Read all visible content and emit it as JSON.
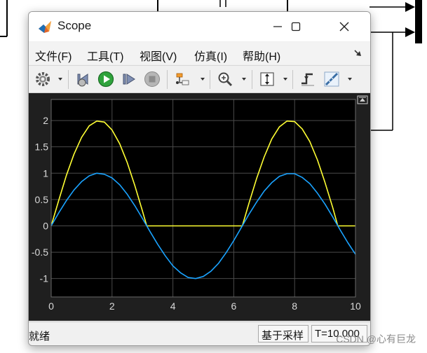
{
  "window": {
    "title": "Scope",
    "controls": {
      "minimize": "—",
      "maximize": "☐",
      "close": "✕"
    }
  },
  "menu": [
    "文件(F)",
    "工具(T)",
    "视图(V)",
    "仿真(I)",
    "帮助(H)"
  ],
  "toolbar": {
    "icons": [
      "settings-icon",
      "step-back-icon",
      "run-icon",
      "step-forward-icon",
      "stop-icon",
      "signal-selector-icon",
      "zoom-icon",
      "autoscale-icon",
      "triggers-icon",
      "measurements-icon"
    ]
  },
  "status": {
    "left": "就绪",
    "sampling": "基于采样",
    "time": "T=10.000"
  },
  "watermark": "CSDN @心有巨龙",
  "colors": {
    "plot_bg": "#000000",
    "frame_bg": "#1f1f1f",
    "grid": "#4a4a4a",
    "tick_text": "#d9d9d9",
    "series_1": "#ffff33",
    "series_2": "#1aa3ff"
  },
  "chart_data": {
    "type": "line",
    "title": "",
    "xlabel": "",
    "ylabel": "",
    "xlim": [
      0,
      10
    ],
    "ylim": [
      -1.35,
      2.4
    ],
    "xticks": [
      0,
      2,
      4,
      6,
      8,
      10
    ],
    "yticks": [
      -1,
      -0.5,
      0,
      0.5,
      1,
      1.5,
      2
    ],
    "ytick_labels": [
      "-1",
      "-0.5",
      "0",
      "0.5",
      "1",
      "1.5",
      "2"
    ],
    "grid": true,
    "legend": "none",
    "series": [
      {
        "color": "#ffff33",
        "x": [
          0,
          0.25,
          0.5,
          0.75,
          1,
          1.25,
          1.5,
          1.75,
          2,
          2.25,
          2.5,
          2.75,
          3,
          3.14,
          3.5,
          4,
          4.5,
          5,
          5.5,
          6,
          6.28,
          6.5,
          6.75,
          7,
          7.25,
          7.5,
          7.75,
          8,
          8.25,
          8.5,
          8.75,
          9,
          9.25,
          9.42,
          9.75,
          10
        ],
        "y": [
          0,
          0.49,
          0.96,
          1.36,
          1.68,
          1.9,
          1.99,
          1.97,
          1.82,
          1.56,
          1.2,
          0.76,
          0.28,
          0,
          0,
          0,
          0,
          0,
          0,
          0,
          0,
          0.43,
          0.9,
          1.31,
          1.65,
          1.88,
          1.99,
          1.98,
          1.84,
          1.6,
          1.25,
          0.82,
          0.35,
          0,
          0,
          0
        ]
      },
      {
        "color": "#1aa3ff",
        "x": [
          0,
          0.25,
          0.5,
          0.75,
          1,
          1.25,
          1.5,
          1.75,
          2,
          2.25,
          2.5,
          2.75,
          3,
          3.25,
          3.5,
          3.75,
          4,
          4.25,
          4.5,
          4.75,
          5,
          5.25,
          5.5,
          5.75,
          6,
          6.25,
          6.5,
          6.75,
          7,
          7.25,
          7.5,
          7.75,
          8,
          8.25,
          8.5,
          8.75,
          9,
          9.25,
          9.5,
          9.75,
          10
        ],
        "y": [
          0,
          0.25,
          0.48,
          0.68,
          0.84,
          0.95,
          1.0,
          0.98,
          0.91,
          0.78,
          0.6,
          0.38,
          0.14,
          -0.11,
          -0.35,
          -0.57,
          -0.76,
          -0.89,
          -0.98,
          -1.0,
          -0.96,
          -0.86,
          -0.71,
          -0.51,
          -0.28,
          -0.03,
          0.22,
          0.45,
          0.66,
          0.82,
          0.94,
          0.99,
          0.99,
          0.92,
          0.8,
          0.62,
          0.41,
          0.17,
          -0.08,
          -0.32,
          -0.54
        ]
      }
    ]
  }
}
